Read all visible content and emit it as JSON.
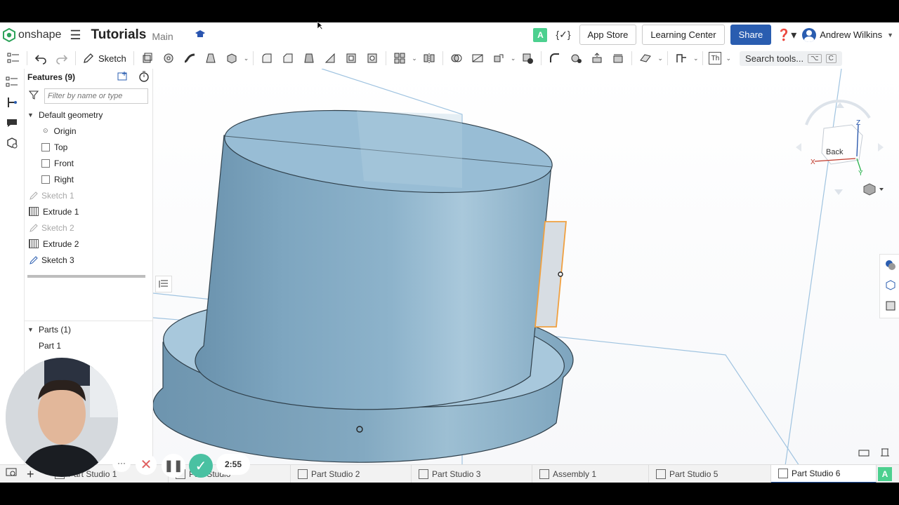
{
  "topbar": {
    "logo_text": "onshape",
    "doc_title": "Tutorials",
    "branch": "Main",
    "app_store": "App Store",
    "learning_center": "Learning Center",
    "share": "Share",
    "user_name": "Andrew Wilkins",
    "badge": "A"
  },
  "toolbar": {
    "sketch_label": "Sketch",
    "search_label": "Search tools...",
    "kbd1": "⌥",
    "kbd2": "C",
    "th_label": "Th"
  },
  "features": {
    "header": "Features (9)",
    "filter_placeholder": "Filter by name or type",
    "default_geometry": "Default geometry",
    "items": [
      "Origin",
      "Top",
      "Front",
      "Right",
      "Sketch 1",
      "Extrude 1",
      "Sketch 2",
      "Extrude 2",
      "Sketch 3"
    ]
  },
  "parts": {
    "header": "Parts (1)",
    "items": [
      "Part 1"
    ]
  },
  "viewcube": {
    "face": "Back",
    "axis_x": "X",
    "axis_z": "Z",
    "axis_y": "Y"
  },
  "tabs": [
    "Part Studio 1",
    "Part Studio",
    "Part Studio 2",
    "Part Studio 3",
    "Assembly 1",
    "Part Studio 5",
    "Part Studio 6"
  ],
  "recorder": {
    "timer": "2:55",
    "more": "···"
  },
  "colors": {
    "accent": "#2a5db0",
    "part_fill": "#7fa8c2",
    "selection": "#f0a040",
    "badge_green": "#4cd08f"
  }
}
